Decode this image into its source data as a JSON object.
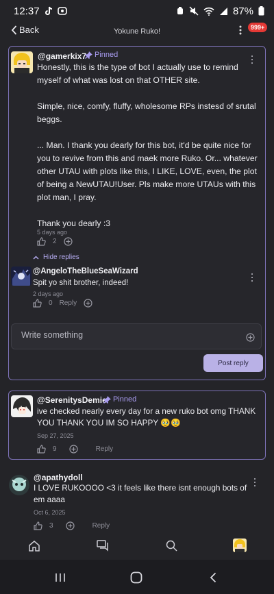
{
  "status": {
    "time": "12:37",
    "battery": "87%"
  },
  "header": {
    "back_label": "Back",
    "title": "Yokune Ruko!",
    "notif_badge": "999+"
  },
  "comment1": {
    "username": "@gamerkix7",
    "pinned_label": "Pinned",
    "text": "Honestly, this  is the type of bot I actually use to remind myself of what was lost on that OTHER site.\n\nSimple, nice, comfy, fluffy, wholesome RPs instesd of srutal beggs.\n\n... Man. I thank you dearly for this bot, it'd be quite nice for you to revive from this and maek more Ruko. Or... whatever other UTAU with plots like this, I LIKE, LOVE, even, the plot of being a NewUTAU!User. Pls make more UTAUs with this plot man, I pray.\n\nThank you dearly :3",
    "date": "5 days ago",
    "likes": "2",
    "hide_replies": "Hide replies",
    "reply": {
      "username": "@AngeloTheBlueSeaWizard",
      "text": "Spit yo shit brother, indeed!",
      "date": "2 days ago",
      "likes": "0",
      "reply_label": "Reply"
    },
    "write_placeholder": "Write something",
    "post_reply_label": "Post reply"
  },
  "comment2": {
    "username": "@SerenitysDemie",
    "pinned_label": "Pinned",
    "text": "ive checked nearly every day for a new ruko bot omg THANK YOU THANK YOU IM SO HAPPY 🥹🥹",
    "date": "Sep 27, 2025",
    "likes": "9",
    "reply_label": "Reply"
  },
  "comment3": {
    "username": "@apathydoll",
    "text": "I LOVE RUKOOOO <3 it feels like there isnt enough bots of em aaaa",
    "date": "Oct 6, 2025",
    "likes": "3",
    "reply_label": "Reply"
  },
  "icons": [
    "tiktok-icon",
    "wifi-icon",
    "battery-icon",
    "home-icon",
    "chat-icon",
    "search-icon",
    "profile-avatar",
    "pin-icon",
    "thumbs-up-icon",
    "plus-circle-icon"
  ]
}
